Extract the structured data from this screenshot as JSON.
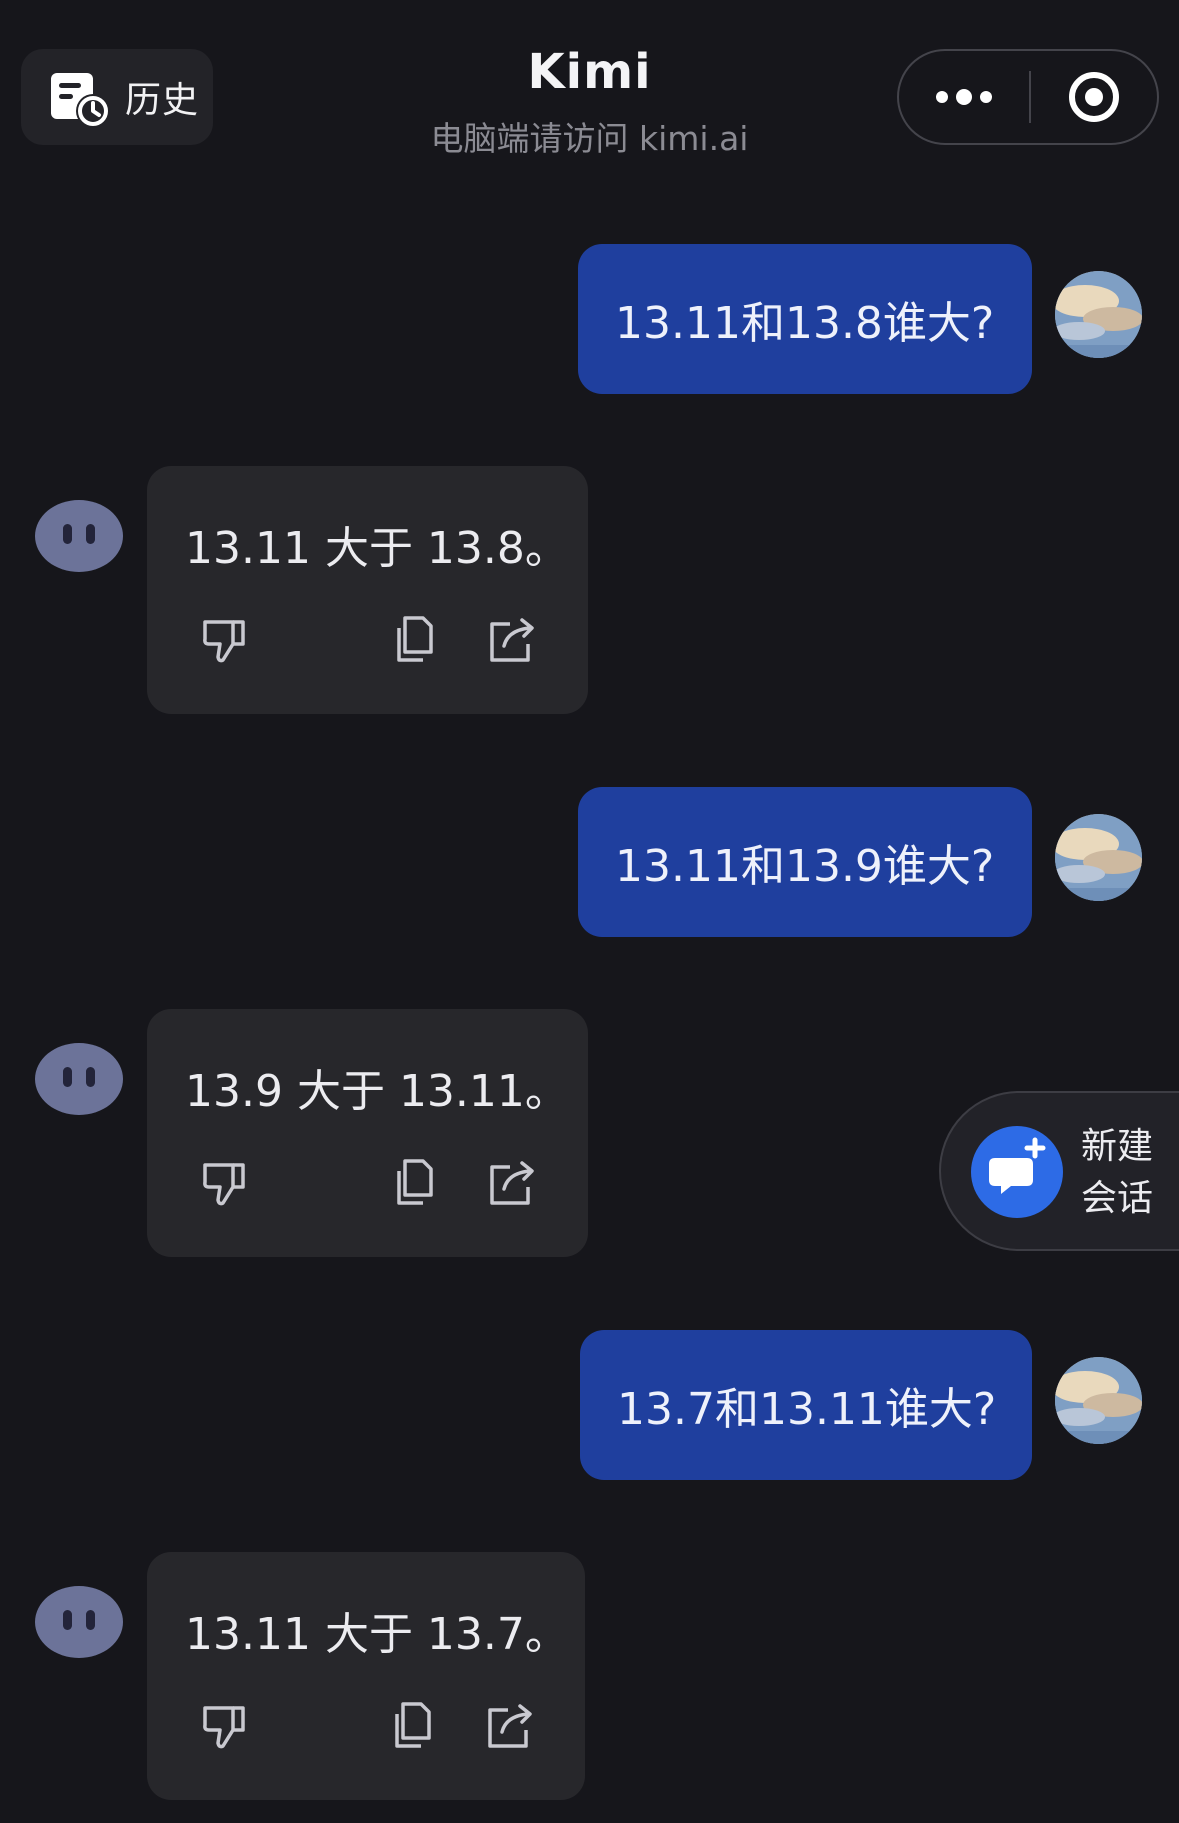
{
  "header": {
    "history_label": "历史",
    "title": "Kimi",
    "subtitle": "电脑端请访问 kimi.ai"
  },
  "messages": [
    {
      "role": "user",
      "text": "13.11和13.8谁大?"
    },
    {
      "role": "assistant",
      "text": "13.11 大于 13.8。"
    },
    {
      "role": "user",
      "text": "13.11和13.9谁大?"
    },
    {
      "role": "assistant",
      "text": "13.9 大于 13.11。"
    },
    {
      "role": "user",
      "text": "13.7和13.11谁大?"
    },
    {
      "role": "assistant",
      "text": "13.11 大于 13.7。"
    }
  ],
  "message_actions": [
    "thumbs-down-icon",
    "copy-icon",
    "share-icon"
  ],
  "new_chat": {
    "label": "新建会话"
  },
  "colors": {
    "background": "#16161b",
    "user_bubble": "#1f3f9e",
    "assistant_bubble": "#27272b",
    "accent": "#2d6be6"
  }
}
